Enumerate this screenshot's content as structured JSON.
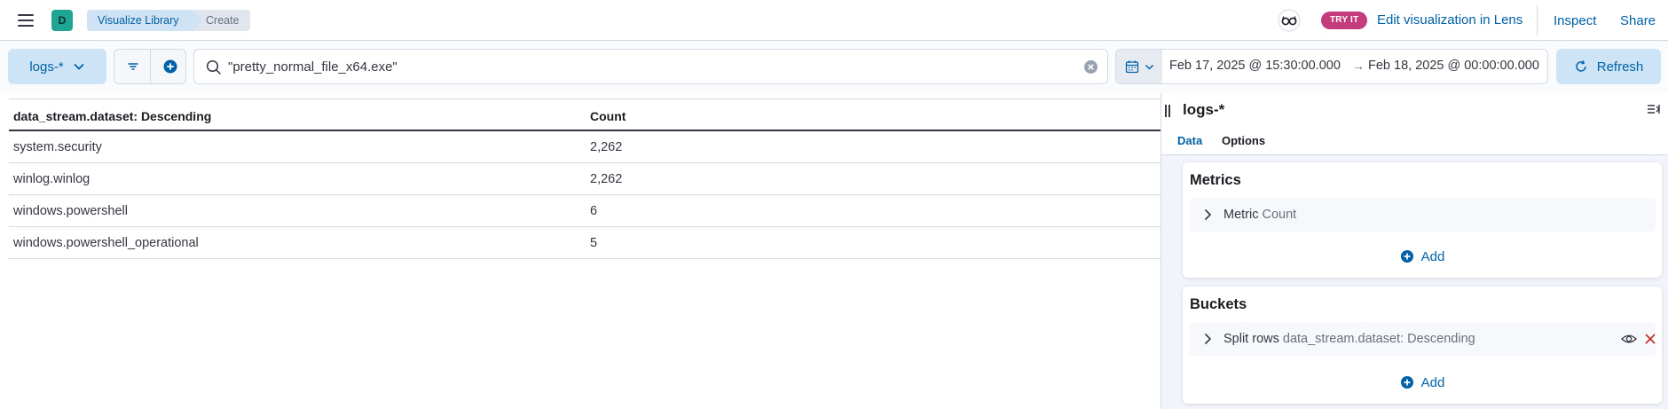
{
  "header": {
    "space_initial": "D",
    "breadcrumbs": [
      "Visualize Library",
      "Create"
    ],
    "try_it_badge": "TRY IT",
    "lens_link": "Edit visualization in Lens",
    "inspect": "Inspect",
    "share": "Share"
  },
  "querybar": {
    "data_view": "logs-*",
    "query": "\"pretty_normal_file_x64.exe\"",
    "date_start": "Feb 17, 2025 @ 15:30:00.000",
    "date_arrow": "→",
    "date_end": "Feb 18, 2025 @ 00:00:00.000",
    "refresh": "Refresh"
  },
  "table": {
    "columns": [
      "data_stream.dataset: Descending",
      "Count"
    ],
    "rows": [
      [
        "system.security",
        "2,262"
      ],
      [
        "winlog.winlog",
        "2,262"
      ],
      [
        "windows.powershell",
        "6"
      ],
      [
        "windows.powershell_operational",
        "5"
      ]
    ]
  },
  "sidebar": {
    "title": "logs-*",
    "tabs": [
      "Data",
      "Options"
    ],
    "metrics": {
      "title": "Metrics",
      "item_label": "Metric",
      "item_desc": "Count",
      "add": "Add"
    },
    "buckets": {
      "title": "Buckets",
      "item_label": "Split rows",
      "item_desc": "data_stream.dataset: Descending",
      "add": "Add"
    }
  },
  "colors": {
    "primary": "#0061a6",
    "primary_light": "#cce4f5",
    "badge_pink": "#c43c7b",
    "avatar_teal": "#1ea593",
    "danger": "#bd271e"
  }
}
